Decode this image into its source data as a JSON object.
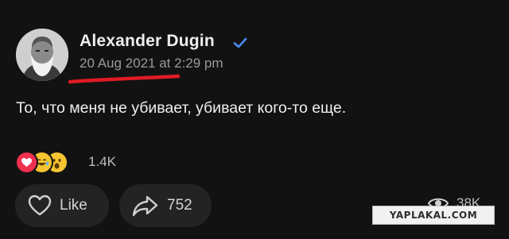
{
  "post": {
    "author_name": "Alexander Dugin",
    "verified_icon": "verified-check-icon",
    "timestamp": "20 Aug 2021 at 2:29 pm",
    "text": "То, что меня не убивает, убивает кого-то еще.",
    "reactions": {
      "icons": [
        "heart-reaction-icon",
        "laugh-tears-reaction-icon",
        "wow-reaction-icon"
      ],
      "count": "1.4K"
    },
    "actions": {
      "like_label": "Like",
      "share_count": "752",
      "views_count": "38K"
    }
  },
  "watermark": {
    "text": "YAPLAKAL.COM"
  },
  "colors": {
    "background": "#121212",
    "verified": "#4c8bf5",
    "annotation_underline": "#e01b24",
    "love_reaction": "#f0304f"
  }
}
